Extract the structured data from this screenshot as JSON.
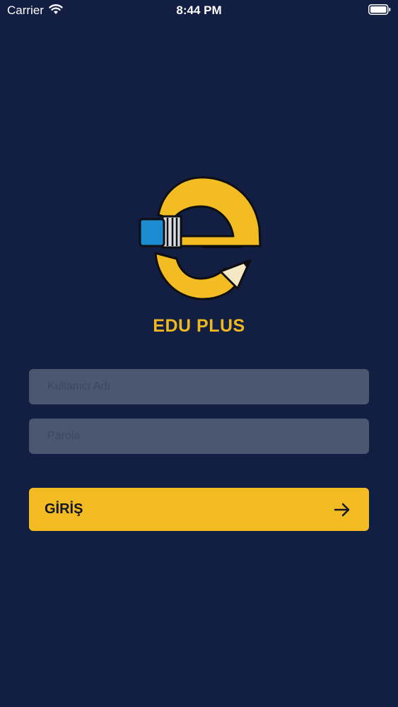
{
  "status_bar": {
    "carrier": "Carrier",
    "time": "8:44 PM"
  },
  "brand": {
    "name": "EDU PLUS",
    "logo_icon": "pencil-e-logo-icon",
    "accent_color": "#efb820"
  },
  "login_form": {
    "username_placeholder": "Kullanıcı Adı",
    "password_placeholder": "Parola",
    "submit_label": "GİRİŞ",
    "submit_icon": "arrow-right-icon"
  },
  "colors": {
    "background": "#121e42",
    "field_background": "#4b5670",
    "button_background": "#f2bc22"
  }
}
